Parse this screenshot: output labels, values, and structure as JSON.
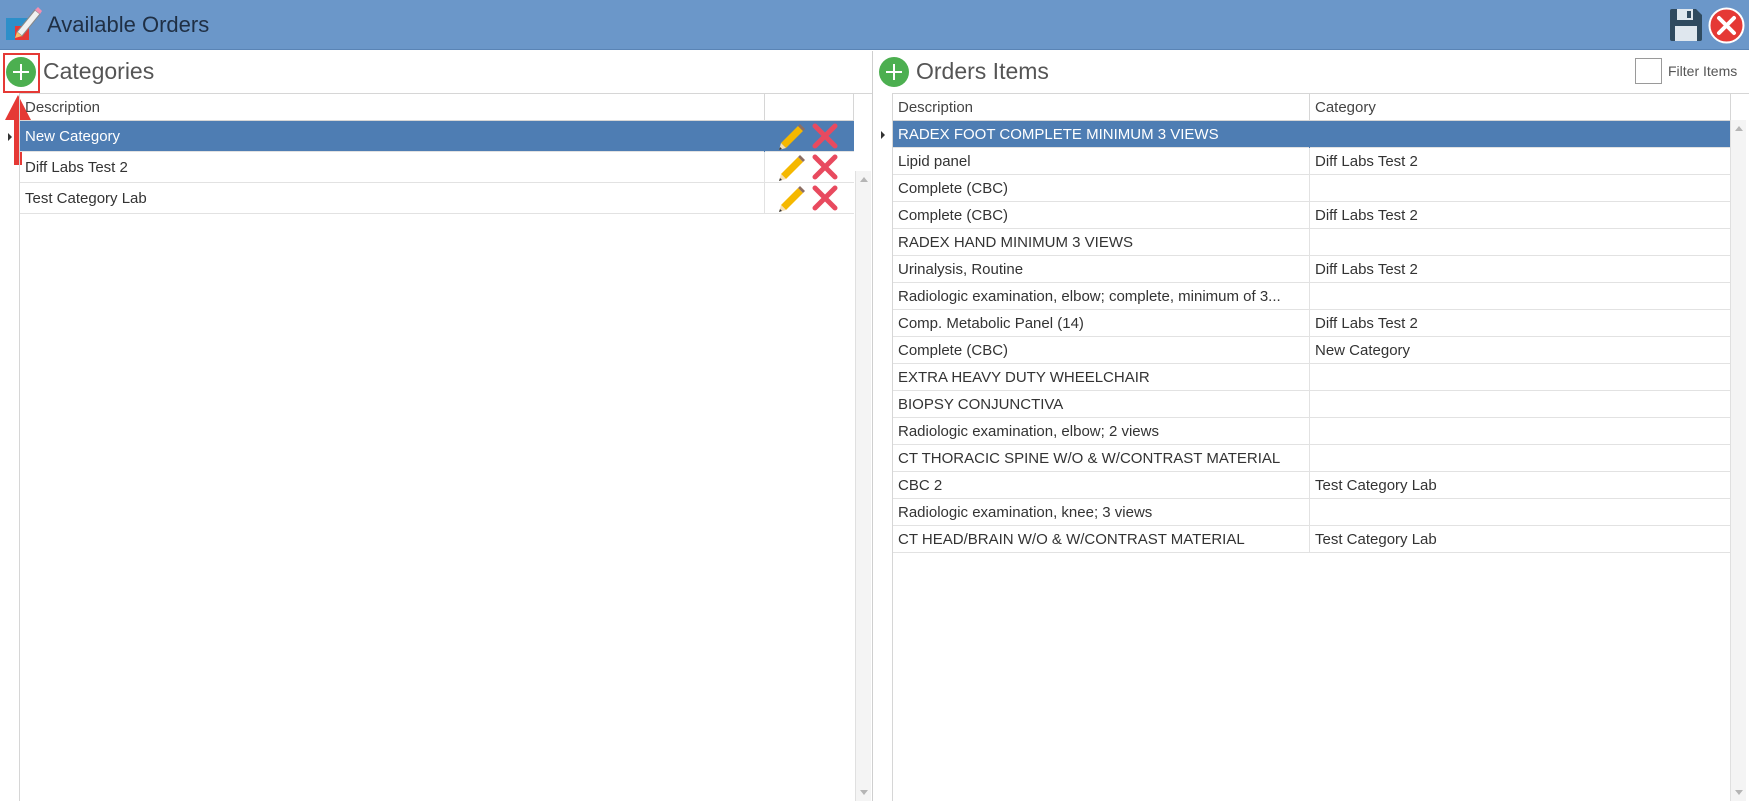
{
  "window": {
    "title": "Available Orders",
    "icons": [
      "app-pencil-icon",
      "save-disk-icon",
      "close-red-icon"
    ]
  },
  "categories": {
    "title": "Categories",
    "columns": [
      "Description"
    ],
    "rows": [
      {
        "description": "New Category",
        "selected": true
      },
      {
        "description": "Diff Labs Test 2",
        "selected": false
      },
      {
        "description": "Test Category Lab",
        "selected": false
      }
    ],
    "row_icons": [
      "edit-pencil-icon",
      "delete-x-icon"
    ]
  },
  "orders": {
    "title": "Orders Items",
    "filter_label": "Filter Items",
    "columns": [
      "Description",
      "Category"
    ],
    "rows": [
      {
        "description": "RADEX FOOT COMPLETE MINIMUM 3 VIEWS",
        "category": "",
        "selected": true
      },
      {
        "description": "Lipid panel",
        "category": "Diff Labs Test 2",
        "selected": false
      },
      {
        "description": "Complete (CBC)",
        "category": "",
        "selected": false
      },
      {
        "description": "Complete (CBC)",
        "category": "Diff Labs Test 2",
        "selected": false
      },
      {
        "description": "RADEX HAND MINIMUM 3 VIEWS",
        "category": "",
        "selected": false
      },
      {
        "description": "Urinalysis, Routine",
        "category": "Diff Labs Test 2",
        "selected": false
      },
      {
        "description": "Radiologic examination, elbow; complete, minimum of 3...",
        "category": "",
        "selected": false
      },
      {
        "description": "Comp. Metabolic Panel (14)",
        "category": "Diff Labs Test 2",
        "selected": false
      },
      {
        "description": "Complete (CBC)",
        "category": "New Category",
        "selected": false
      },
      {
        "description": "EXTRA HEAVY DUTY WHEELCHAIR",
        "category": "",
        "selected": false
      },
      {
        "description": "BIOPSY CONJUNCTIVA",
        "category": "",
        "selected": false
      },
      {
        "description": "Radiologic examination, elbow; 2 views",
        "category": "",
        "selected": false
      },
      {
        "description": "CT THORACIC SPINE W/O & W/CONTRAST MATERIAL",
        "category": "",
        "selected": false
      },
      {
        "description": "CBC 2",
        "category": "Test Category Lab",
        "selected": false
      },
      {
        "description": "Radiologic examination, knee; 3 views",
        "category": "",
        "selected": false
      },
      {
        "description": "CT HEAD/BRAIN W/O & W/CONTRAST MATERIAL",
        "category": "Test Category Lab",
        "selected": false
      }
    ]
  },
  "colors": {
    "titlebar": "#6b97c9",
    "selected_row": "#4e7db3",
    "add_button": "#4caf50",
    "delete_icon": "#e84a5f",
    "highlight": "#e53935"
  }
}
